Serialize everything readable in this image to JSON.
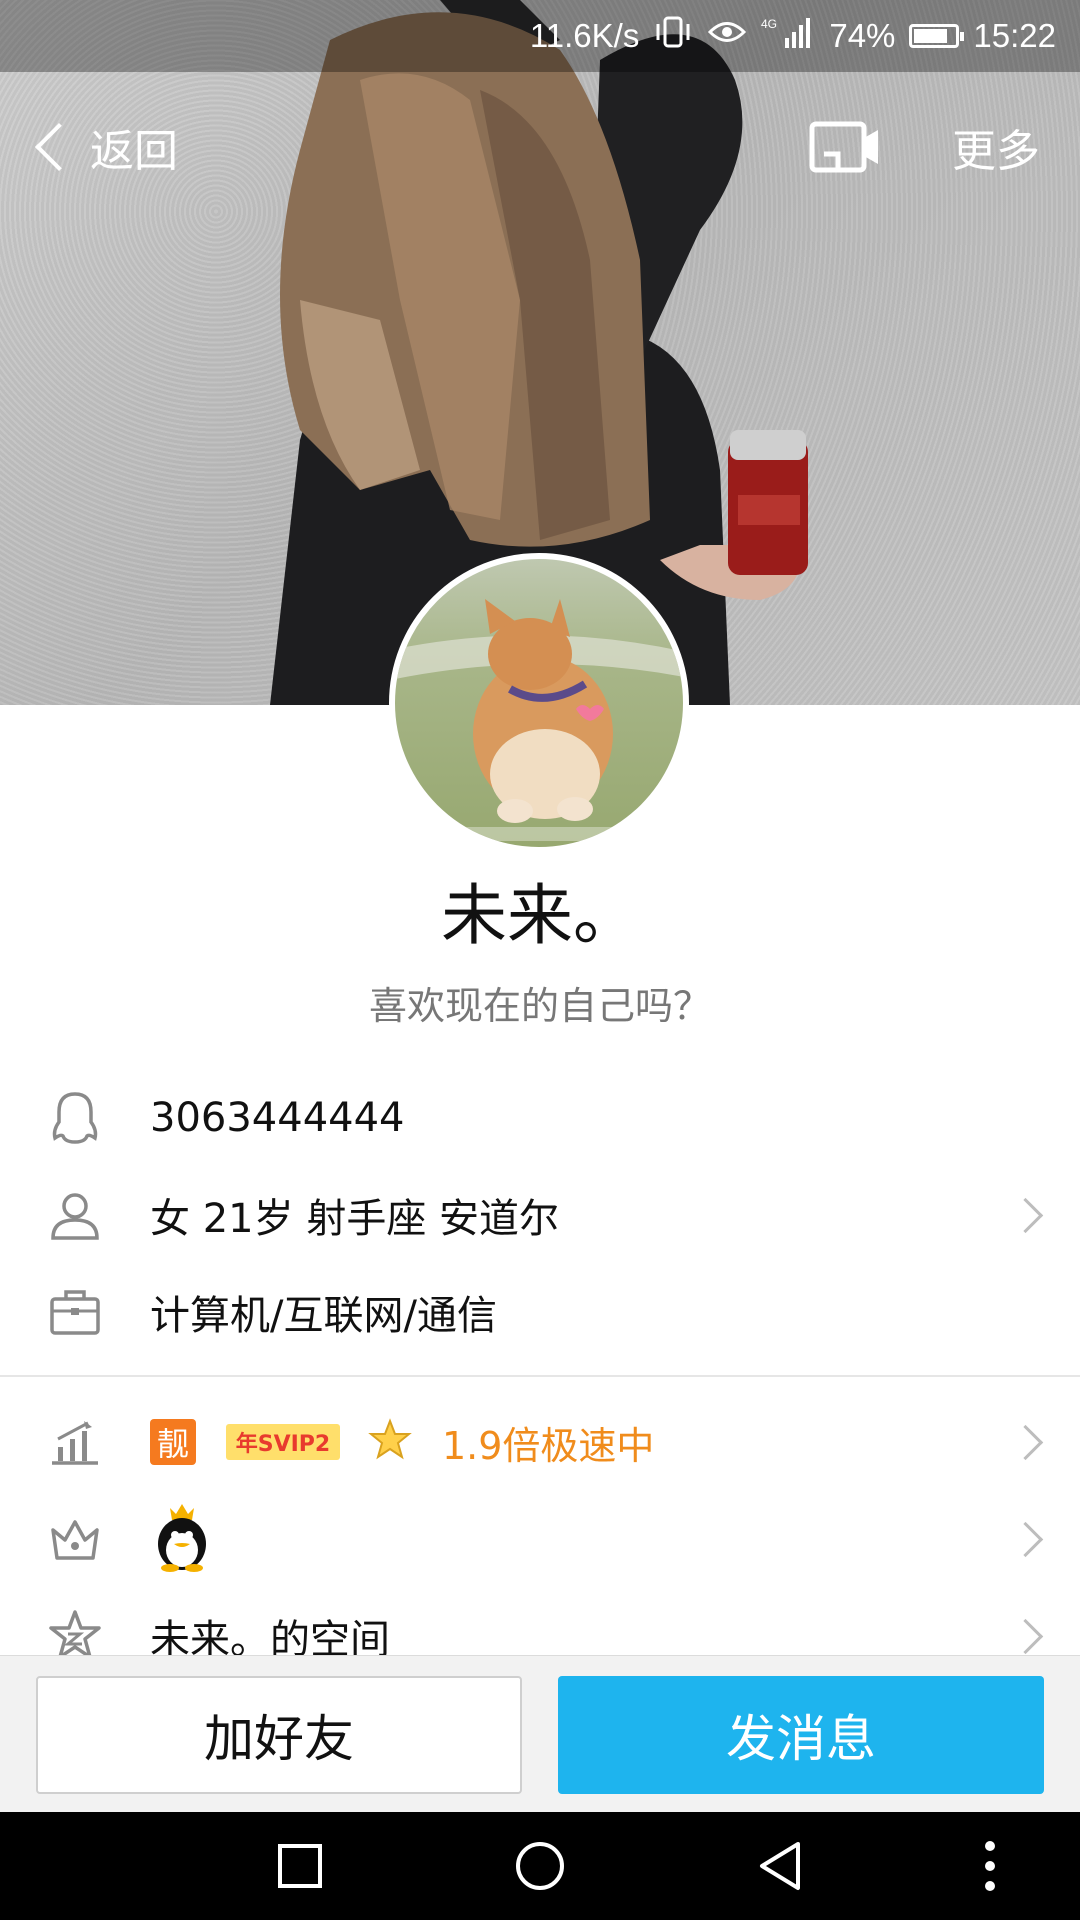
{
  "status_bar": {
    "net_speed": "11.6K/s",
    "network_type": "4G",
    "battery": "74%",
    "battery_level": 0.74,
    "time": "15:22",
    "icons": [
      "vibrate-icon",
      "eye-icon",
      "signal-icon",
      "battery-icon"
    ]
  },
  "nav": {
    "back_label": "返回",
    "more_label": "更多",
    "cast_icon": "screen-cast-icon"
  },
  "profile": {
    "name": "未来。",
    "signature": "喜欢现在的自己吗？"
  },
  "info": {
    "qq_number": "3063444444",
    "basic_info": "女  21岁  射手座  安道尔",
    "occupation": "计算机/互联网/通信"
  },
  "privileges": {
    "liang_badge": "靓",
    "svip_badge": "年SVIP2",
    "speed_text": "1.9倍极速中"
  },
  "space": {
    "label": "未来。的空间"
  },
  "actions": {
    "add_friend": "加好友",
    "send_message": "发消息"
  },
  "colors": {
    "accent_blue": "#1eb4ee",
    "speed_orange": "#f08c1c",
    "badge_orange": "#f57a1f"
  }
}
